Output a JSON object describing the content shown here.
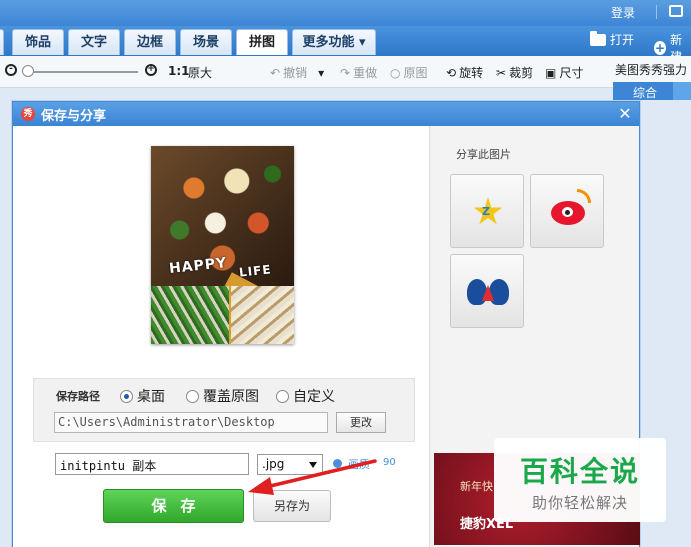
{
  "topbar": {
    "login": "登录"
  },
  "tabs": [
    {
      "label": "饰品"
    },
    {
      "label": "文字"
    },
    {
      "label": "边框"
    },
    {
      "label": "场景"
    },
    {
      "label": "拼图"
    },
    {
      "label": "更多功能"
    }
  ],
  "header_actions": {
    "open": "打开",
    "new": "新建"
  },
  "toolbar": {
    "zoom_ratio": "1:1",
    "original_size": "原大",
    "undo": "撤销",
    "redo": "重做",
    "original": "原图",
    "rotate": "旋转",
    "crop": "裁剪",
    "size": "尺寸"
  },
  "right_panel": {
    "title": "美图秀秀强力",
    "tab": "综合"
  },
  "dialog": {
    "title": "保存与分享",
    "photo": {
      "line1": "HAPPY",
      "line2": "LIFE"
    },
    "save_path": {
      "label": "保存路径",
      "options": [
        "桌面",
        "覆盖原图",
        "自定义"
      ],
      "selected": "桌面",
      "path": "C:\\Users\\Administrator\\Desktop",
      "change_label": "更改"
    },
    "filename": "initpintu 副本",
    "extension": ".jpg",
    "quality_label": "画质",
    "quality_value": "90",
    "save_label": "保存",
    "save_as_label": "另存为",
    "share_title": "分享此图片",
    "share_targets": [
      "qzone",
      "weibo",
      "renren"
    ],
    "ad": {
      "line1": "新年快",
      "line2": "捷豹XEL"
    }
  },
  "watermark": {
    "main": "百科全说",
    "sub": "助你轻松解决"
  },
  "colors": {
    "titlebar": "#3a84d2",
    "save_button": "#2fa82a",
    "arrow": "#e02020"
  }
}
